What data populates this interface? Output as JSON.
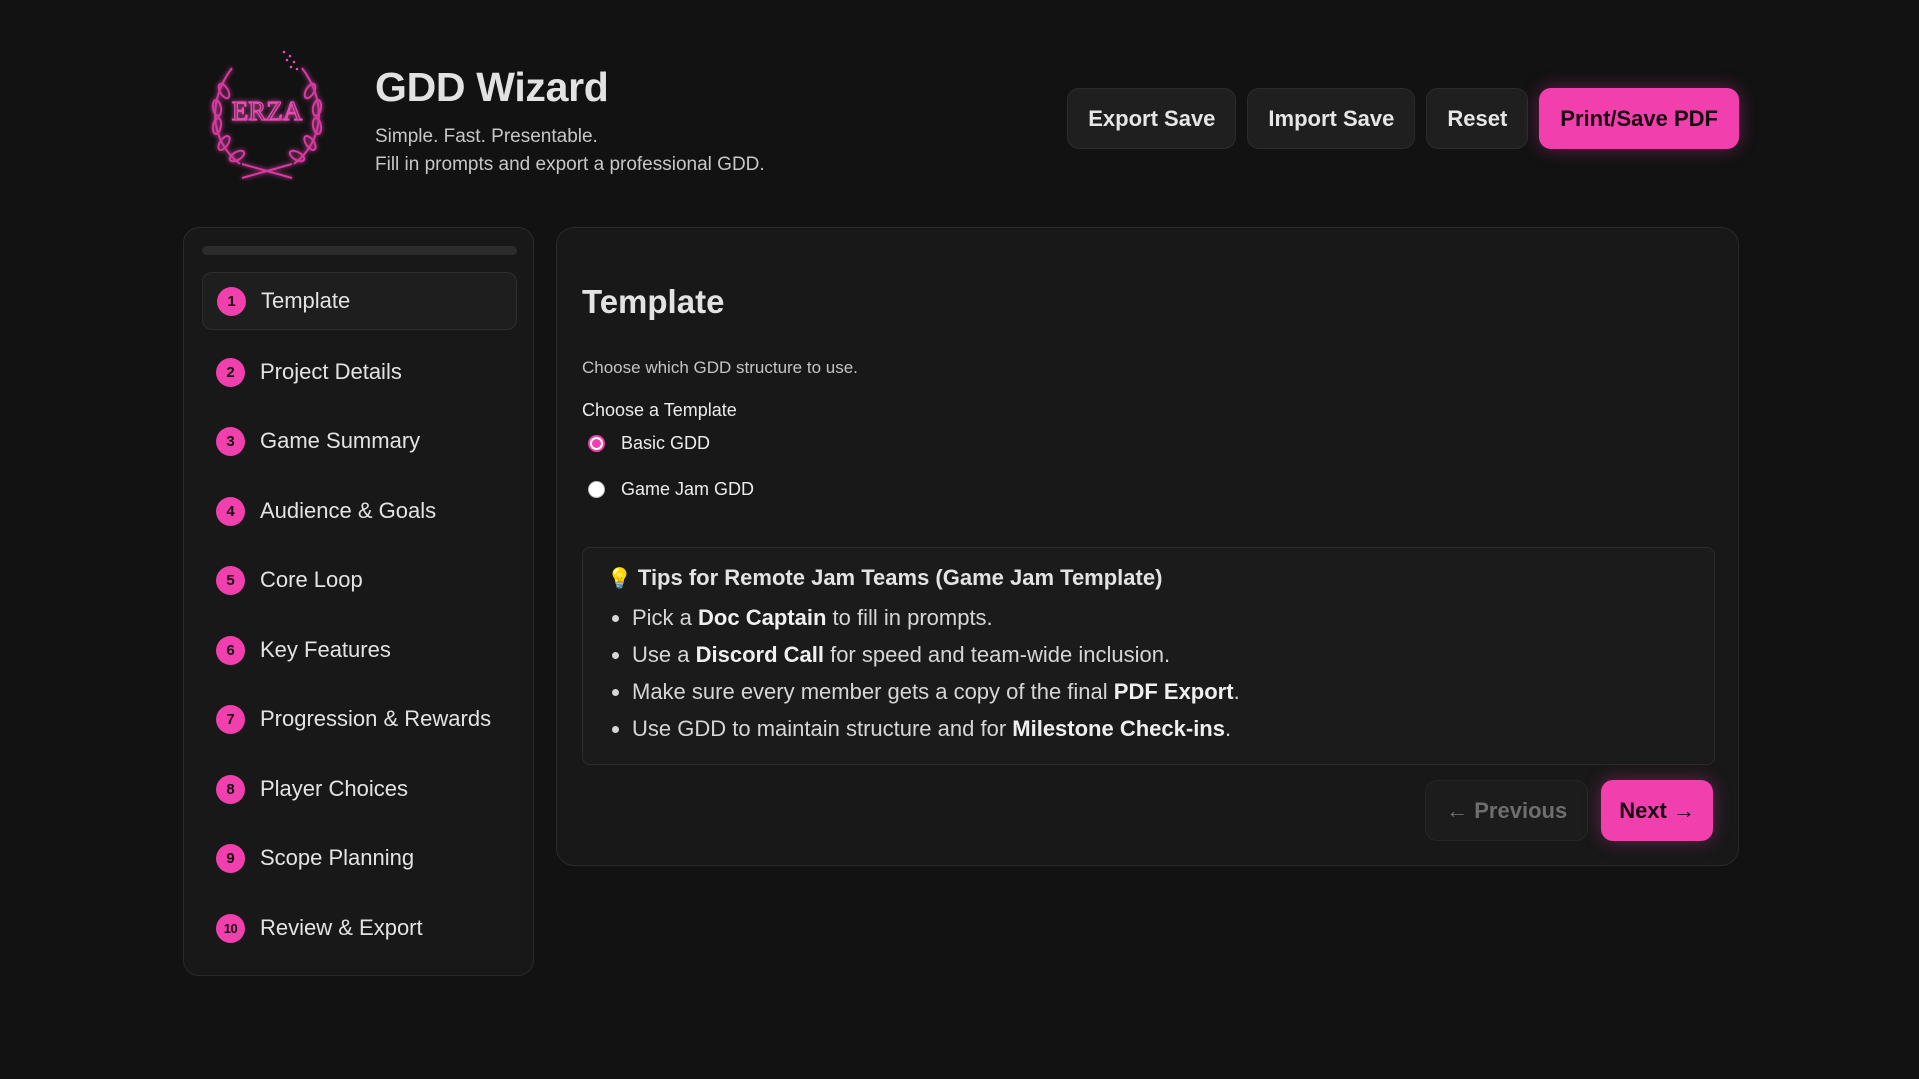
{
  "header": {
    "logo_text": "ERZA",
    "title": "GDD Wizard",
    "subtitle_line1": "Simple. Fast. Presentable.",
    "subtitle_line2": "Fill in prompts and export a professional GDD.",
    "buttons": {
      "export_save": "Export Save",
      "import_save": "Import Save",
      "reset": "Reset",
      "print_pdf": "Print/Save PDF"
    }
  },
  "sidebar": {
    "progress": 0,
    "steps": [
      {
        "num": "1",
        "label": "Template"
      },
      {
        "num": "2",
        "label": "Project Details"
      },
      {
        "num": "3",
        "label": "Game Summary"
      },
      {
        "num": "4",
        "label": "Audience & Goals"
      },
      {
        "num": "5",
        "label": "Core Loop"
      },
      {
        "num": "6",
        "label": "Key Features"
      },
      {
        "num": "7",
        "label": "Progression & Rewards"
      },
      {
        "num": "8",
        "label": "Player Choices"
      },
      {
        "num": "9",
        "label": "Scope Planning"
      },
      {
        "num": "10",
        "label": "Review & Export"
      }
    ],
    "active_index": 0
  },
  "main": {
    "title": "Template",
    "description": "Choose which GDD structure to use.",
    "field_label": "Choose a Template",
    "options": [
      {
        "label": "Basic GDD",
        "checked": true
      },
      {
        "label": "Game Jam GDD",
        "checked": false
      }
    ],
    "tips": {
      "icon": "lightbulb-icon",
      "title": "Tips for Remote Jam Teams (Game Jam Template)",
      "items": [
        {
          "pre": "Pick a ",
          "bold": "Doc Captain",
          "post": " to fill in prompts."
        },
        {
          "pre": "Use a ",
          "bold": "Discord Call",
          "post": " for speed and team-wide inclusion."
        },
        {
          "pre": "Make sure every member gets a copy of the final ",
          "bold": "PDF Export",
          "post": "."
        },
        {
          "pre": "Use GDD to maintain structure and for ",
          "bold": "Milestone Check-ins",
          "post": "."
        }
      ]
    },
    "nav": {
      "previous": "Previous",
      "next": "Next"
    }
  },
  "colors": {
    "accent": "#f13fae",
    "background": "#121212",
    "panel": "#181818"
  }
}
